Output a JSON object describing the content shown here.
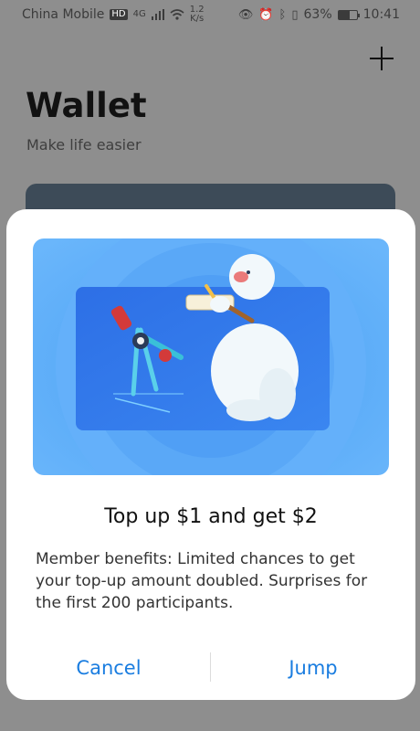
{
  "status_bar": {
    "carrier": "China Mobile",
    "hd": "HD",
    "network": "4G",
    "speed_value": "1.2",
    "speed_unit": "K/s",
    "battery_percent": "63%",
    "battery_level": 0.63,
    "time": "10:41",
    "icons": [
      "eye-icon",
      "alarm-icon",
      "bluetooth-icon",
      "vibrate-icon",
      "signal-icon",
      "wifi-icon",
      "battery-icon"
    ]
  },
  "header": {
    "title": "Wallet",
    "subtitle": "Make life easier",
    "add_icon": "plus-icon"
  },
  "dialog": {
    "title": "Top up $1 and get $2",
    "body": "Member benefits: Limited chances to get your top-up amount doubled. Surprises for the first 200 participants.",
    "cancel_label": "Cancel",
    "jump_label": "Jump",
    "accent_color": "#1a7de0"
  }
}
